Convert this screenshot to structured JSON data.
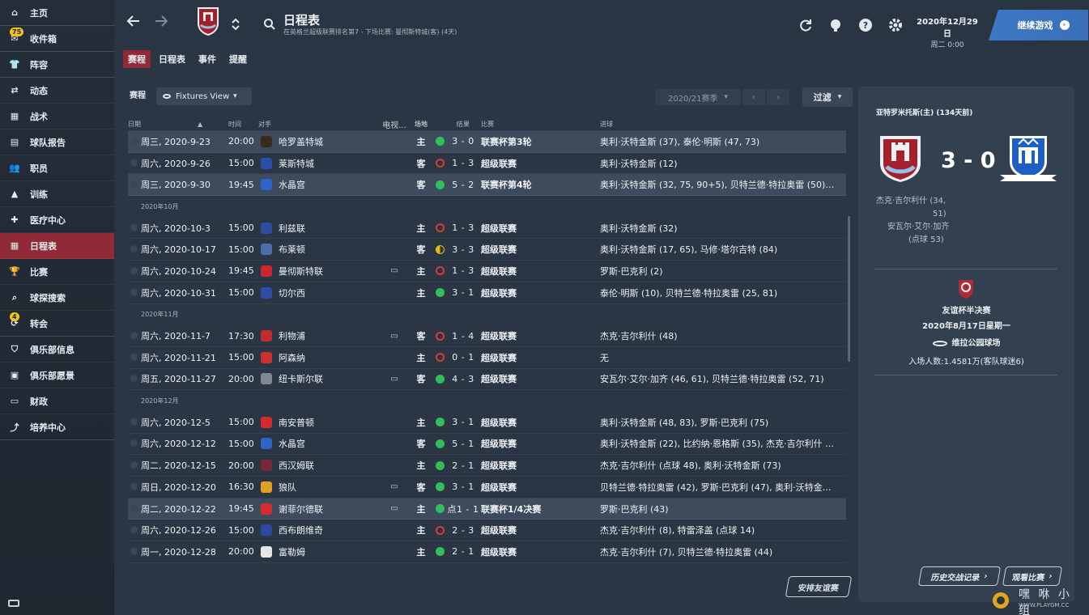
{
  "sidebar": {
    "items": [
      {
        "label": "主页",
        "icon": "home-icon"
      },
      {
        "label": "收件箱",
        "icon": "inbox-icon",
        "badge": "75"
      },
      {
        "label": "阵容",
        "icon": "shirt-icon"
      },
      {
        "label": "动态",
        "icon": "dynamics-icon"
      },
      {
        "label": "战术",
        "icon": "tactics-icon"
      },
      {
        "label": "球队报告",
        "icon": "report-icon"
      },
      {
        "label": "职员",
        "icon": "staff-icon"
      },
      {
        "label": "训练",
        "icon": "training-icon"
      },
      {
        "label": "医疗中心",
        "icon": "medical-icon"
      },
      {
        "label": "日程表",
        "icon": "calendar-icon",
        "active": true
      },
      {
        "label": "比赛",
        "icon": "trophy-icon"
      },
      {
        "label": "球探搜索",
        "icon": "scout-icon"
      },
      {
        "label": "转会",
        "icon": "transfer-icon",
        "badge": "4"
      },
      {
        "label": "俱乐部信息",
        "icon": "shield-icon"
      },
      {
        "label": "俱乐部愿景",
        "icon": "vision-icon"
      },
      {
        "label": "财政",
        "icon": "finance-icon"
      },
      {
        "label": "培养中心",
        "icon": "development-icon"
      }
    ]
  },
  "header": {
    "title": "日程表",
    "subtitle": "在英格兰超级联赛排名第7 - 下场比赛: 曼彻斯特城(客) (4天)",
    "date_main": "2020年12月29日",
    "date_sub": "周二 0:00",
    "continue_label": "继续游戏"
  },
  "tabs": [
    {
      "label": "赛程",
      "active": true
    },
    {
      "label": "日程表"
    },
    {
      "label": "事件"
    },
    {
      "label": "提醒"
    }
  ],
  "toolbar": {
    "section_label": "赛程",
    "view_label": "Fixtures View",
    "season_label": "2020/21赛季",
    "filter_label": "过滤"
  },
  "table": {
    "headers": {
      "date": "日期",
      "time": "时间",
      "opponent": "对手",
      "tv": "电视...",
      "venue": "场地",
      "result": "结果",
      "competition": "比赛",
      "goals": "进球"
    },
    "rows": [
      {
        "date": "周三, 2020-9-23",
        "time": "20:00",
        "opp": "哈罗盖特城",
        "crest": "#3a2a1c",
        "tv": "",
        "venue": "主",
        "res": "W",
        "score": "3 - 0",
        "comp": "联赛杯第3轮",
        "goals": "奥利·沃特金斯 (37), 泰伦·明斯 (47, 73)",
        "hl": true
      },
      {
        "date": "周六, 2020-9-26",
        "time": "15:00",
        "opp": "莱斯特城",
        "crest": "#2b4fa8",
        "tv": "",
        "venue": "客",
        "res": "L",
        "score": "1 - 3",
        "comp": "超级联赛",
        "goals": "奥利·沃特金斯 (12)"
      },
      {
        "date": "周三, 2020-9-30",
        "time": "19:45",
        "opp": "水晶宫",
        "crest": "#2d64c8",
        "tv": "",
        "venue": "客",
        "res": "W",
        "score": "5 - 2",
        "comp": "联赛杯第4轮",
        "goals": "奥利·沃特金斯 (32, 75, 90+5), 贝特兰德·特拉奥雷 (50), 安...",
        "hl": true
      },
      {
        "month": "2020年10月"
      },
      {
        "date": "周六, 2020-10-3",
        "time": "15:00",
        "opp": "利兹联",
        "crest": "#2b4f9e",
        "tv": "",
        "venue": "主",
        "res": "L",
        "score": "1 - 3",
        "comp": "超级联赛",
        "goals": "奥利·沃特金斯 (32)"
      },
      {
        "date": "周六, 2020-10-17",
        "time": "15:00",
        "opp": "布莱顿",
        "crest": "#4c6ea8",
        "tv": "",
        "venue": "客",
        "res": "D",
        "score": "3 - 3",
        "comp": "超级联赛",
        "goals": "奥利·沃特金斯 (17, 65), 马修·塔尔吉特 (84)"
      },
      {
        "date": "周六, 2020-10-24",
        "time": "19:45",
        "opp": "曼彻斯特联",
        "crest": "#c9262d",
        "tv": "▭",
        "venue": "主",
        "res": "L",
        "score": "1 - 3",
        "comp": "超级联赛",
        "goals": "罗斯·巴克利 (2)"
      },
      {
        "date": "周六, 2020-10-31",
        "time": "15:00",
        "opp": "切尔西",
        "crest": "#2c4ea6",
        "tv": "",
        "venue": "主",
        "res": "W",
        "score": "3 - 1",
        "comp": "超级联赛",
        "goals": "泰伦·明斯 (10), 贝特兰德·特拉奥雷 (25, 81)"
      },
      {
        "month": "2020年11月"
      },
      {
        "date": "周六, 2020-11-7",
        "time": "17:30",
        "opp": "利物浦",
        "crest": "#c12b2f",
        "tv": "▭",
        "venue": "客",
        "res": "L",
        "score": "1 - 4",
        "comp": "超级联赛",
        "goals": "杰克·吉尔利什 (48)"
      },
      {
        "date": "周六, 2020-11-21",
        "time": "15:00",
        "opp": "阿森纳",
        "crest": "#d12f2f",
        "tv": "",
        "venue": "主",
        "res": "L",
        "score": "0 - 1",
        "comp": "超级联赛",
        "goals": "无"
      },
      {
        "date": "周五, 2020-11-27",
        "time": "20:00",
        "opp": "纽卡斯尔联",
        "crest": "#7f8790",
        "tv": "▭",
        "venue": "客",
        "res": "W",
        "score": "4 - 3",
        "comp": "超级联赛",
        "goals": "安瓦尔·艾尔·加齐 (46, 61), 贝特兰德·特拉奥雷 (52, 71)"
      },
      {
        "month": "2020年12月"
      },
      {
        "date": "周六, 2020-12-5",
        "time": "15:00",
        "opp": "南安普顿",
        "crest": "#d22b31",
        "tv": "",
        "venue": "主",
        "res": "W",
        "score": "3 - 1",
        "comp": "超级联赛",
        "goals": "奥利·沃特金斯 (48, 83), 罗斯·巴克利 (75)"
      },
      {
        "date": "周六, 2020-12-12",
        "time": "15:00",
        "opp": "水晶宫",
        "crest": "#2d64c8",
        "tv": "",
        "venue": "客",
        "res": "W",
        "score": "5 - 1",
        "comp": "超级联赛",
        "goals": "奥利·沃特金斯 (22), 比约纳·恩格斯 (35), 杰克·吉尔利什 (3..."
      },
      {
        "date": "周二, 2020-12-15",
        "time": "20:00",
        "opp": "西汉姆联",
        "crest": "#7a2739",
        "tv": "",
        "venue": "主",
        "res": "W",
        "score": "2 - 1",
        "comp": "超级联赛",
        "goals": "杰克·吉尔利什 (点球 48), 奥利·沃特金斯 (73)"
      },
      {
        "date": "周日, 2020-12-20",
        "time": "16:30",
        "opp": "狼队",
        "crest": "#e0a021",
        "tv": "▭",
        "venue": "客",
        "res": "W",
        "score": "3 - 1",
        "comp": "超级联赛",
        "goals": "贝特兰德·特拉奥雷 (42), 罗斯·巴克利 (47), 奥利·沃特金斯..."
      },
      {
        "date": "周二, 2020-12-22",
        "time": "19:45",
        "opp": "谢菲尔德联",
        "crest": "#d52b33",
        "tv": "▭",
        "venue": "主",
        "res": "W",
        "score": "点1 - 1",
        "comp": "联赛杯1/4决赛",
        "goals": "罗斯·巴克利 (43)",
        "hl": true
      },
      {
        "date": "周六, 2020-12-26",
        "time": "15:00",
        "opp": "西布朗维奇",
        "crest": "#2a4aa0",
        "tv": "",
        "venue": "主",
        "res": "L",
        "score": "2 - 3",
        "comp": "超级联赛",
        "goals": "杰克·吉尔利什 (8), 特雷泽盖 (点球 14)"
      },
      {
        "date": "周一, 2020-12-28",
        "time": "20:00",
        "opp": "富勒姆",
        "crest": "#e6e6e6",
        "tv": "",
        "venue": "主",
        "res": "W",
        "score": "2 - 1",
        "comp": "超级联赛",
        "goals": "杰克·吉尔利什 (7), 贝特兰德·特拉奥雷 (44)"
      }
    ]
  },
  "friendly_button": "安排友谊赛",
  "match_panel": {
    "title": "亚特罗米托斯(主) (134天前)",
    "score": "3 - 0",
    "scorers_left_1": "杰克·吉尔利什 (34,",
    "scorers_left_2": "51)",
    "scorers_left_3": "安瓦尔·艾尔·加齐",
    "scorers_left_4": "(点球 53)",
    "competition": "友谊杯半决赛",
    "date": "2020年8月17日星期一",
    "stadium": "维拉公园球场",
    "attendance": "入场人数:1.4581万(客队球迷6)",
    "history_button": "历史交战记录",
    "watch_button": "观看比赛"
  },
  "watermark": {
    "top": "嘿 咻 小 组",
    "bottom": "WWW.PLAYGM.CC"
  },
  "colors": {
    "accent": "#8f2a36",
    "win": "#2fbf5b",
    "loss": "#d93a34",
    "draw": "#e8b80e",
    "continue": "#3d78c4"
  }
}
